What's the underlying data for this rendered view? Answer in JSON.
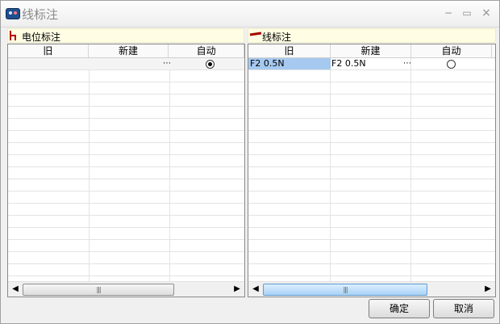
{
  "window": {
    "title": "线标注"
  },
  "left": {
    "section_title": "电位标注",
    "columns": [
      "旧",
      "新建",
      "自动"
    ],
    "rows": [
      {
        "old": "",
        "new": "",
        "auto_selected": true
      }
    ]
  },
  "right": {
    "section_title": "线标注",
    "columns": [
      "旧",
      "新建",
      "自动"
    ],
    "rows": [
      {
        "old": "F2 0.5N",
        "new": "F2 0.5N",
        "auto_selected": false
      }
    ]
  },
  "icons": {
    "app": "app-icon",
    "left_section": "wire-potential-icon",
    "right_section": "wire-icon",
    "ellipsis": "⋯",
    "scroll_left": "◀",
    "scroll_right": "▶",
    "grip": "|||"
  },
  "buttons": {
    "ok": "确定",
    "cancel": "取消"
  }
}
